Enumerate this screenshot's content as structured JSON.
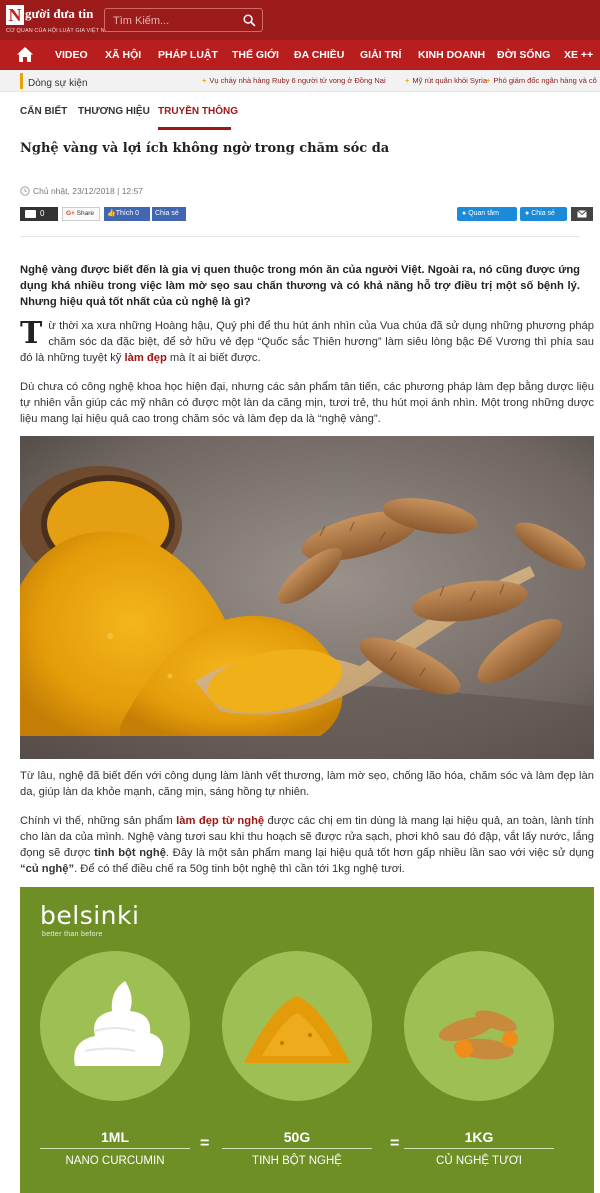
{
  "header": {
    "logo_letter": "N",
    "logo_text": "gười đưa tin",
    "logo_subtitle": "CƠ QUAN CỦA HỘI LUẬT GIA VIỆT NAM",
    "search_placeholder": "Tìm Kiếm...",
    "brand_color": "#9b1a1a"
  },
  "nav": {
    "items": [
      "VIDEO",
      "XÃ HỘI",
      "PHÁP LUẬT",
      "THẾ GIỚI",
      "ĐA CHIỀU",
      "GIẢI TRÍ",
      "KINH DOANH",
      "ĐỜI SỐNG",
      "XE ++"
    ]
  },
  "ticker": {
    "label": "Dòng sự kiện",
    "items": [
      "Vụ cháy nhà hàng Ruby 6 người tử vong ở Đồng Nai",
      "Mỹ rút quân khỏi Syria",
      "Phó giám đốc ngân hàng và cô"
    ]
  },
  "categories": {
    "tabs": [
      "CẨN BIẾT",
      "THƯƠNG HIỆU",
      "TRUYỀN THÔNG"
    ],
    "active": "TRUYỀN THÔNG"
  },
  "article": {
    "title": "Nghệ vàng và lợi ích không ngờ trong chăm sóc da",
    "date": "Chủ nhật, 23/12/2018 | 12:57",
    "sapo": "Nghệ vàng được biết đến là gia vị quen thuộc trong món ăn của người Việt. Ngoài ra, nó cũng được ứng dụng khá nhiều trong việc làm mờ sẹo sau chấn thương và có khả năng hỗ trợ điều trị một số bệnh lý. Nhưng hiệu quả tốt nhất của củ nghệ là gì?",
    "p1_dropcap": "T",
    "p1_a": "ừ thời xa xưa những Hoàng hậu, Quý phi để thu hút ánh nhìn của Vua chúa đã sử dụng những phương pháp chăm sóc da đặc biệt, để sở hữu vẻ đẹp “Quốc sắc Thiên hương” làm siêu lòng bậc Đế Vương thì phía sau đó là những tuyệt kỹ ",
    "p1_link": "làm đẹp",
    "p1_b": " mà ít ai biết được.",
    "p2": "Dù chưa có công nghệ khoa học hiện đại, nhưng các sản phẩm tân tiến, các phương pháp làm đẹp bằng dược liệu tự nhiên vẫn giúp các mỹ nhân có được một làn da căng mịn, tươi trẻ, thu hút mọi ánh nhìn. Một trong những dược liệu mang lại hiệu quả cao trong chăm sóc và làm đẹp da là “nghệ vàng”.",
    "p3": "Từ lâu, nghệ đã biết đến với công dụng làm lành vết thương, làm mờ sẹo, chống lão hóa, chăm sóc và làm đẹp làn da, giúp làn da khỏe mạnh, căng mịn, sáng hồng tự nhiên.",
    "p4_a": "Chính vì thế, những sản phẩm ",
    "p4_link": "làm đẹp từ nghệ",
    "p4_b": " được các chị em tin dùng là mang lại hiệu quả, an toàn, lành tính cho làn da của mình. Nghệ vàng tươi sau khi thu hoạch sẽ được rửa sạch, phơi khô sau đó đập, vắt lấy nước, lắng đọng sẽ được ",
    "p4_bold1": "tinh bột nghệ",
    "p4_c": ". Đây là một sản phẩm mang lại hiệu quả tốt hơn gấp nhiều lần sao với việc sử dụng ",
    "p4_bold2": "“củ nghệ”",
    "p4_d": ". Để có thể điều chế ra 50g tinh bột nghệ thì cần tới 1kg nghệ tươi."
  },
  "share": {
    "comment_count": "0",
    "gshare_label": "Share",
    "like_label": "Thích 0",
    "fb_share_label": "Chia sẻ",
    "follow_label": "Quan tâm",
    "zalo_share_label": "Chia sẻ"
  },
  "promo": {
    "brand": "belsinki",
    "tagline": "better than before",
    "amounts": [
      "1ML",
      "50G",
      "1KG"
    ],
    "labels": [
      "NANO CURCUMIN",
      "TINH BỘT NGHỆ",
      "CỦ NGHỆ TƯƠI"
    ],
    "equals": "="
  }
}
